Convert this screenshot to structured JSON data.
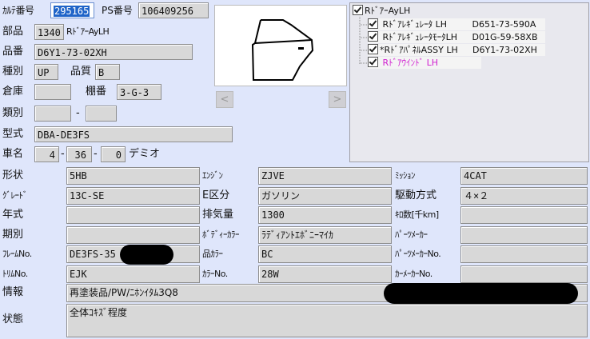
{
  "header": {
    "karte_label": "ｶﾙﾃ番号",
    "karte_value": "295165",
    "ps_label": "PS番号",
    "ps_value": "106409256"
  },
  "part": {
    "label": "部品",
    "code": "1340",
    "name": "RﾄﾞｱｰAyLH"
  },
  "part_number": {
    "label": "品番",
    "value": "D6Y1-73-02XH"
  },
  "kind": {
    "label": "種別",
    "value": "UP",
    "quality_label": "品質",
    "quality_value": "B"
  },
  "warehouse": {
    "label": "倉庫",
    "value": "",
    "shelf_label": "棚番",
    "shelf_value": "3-G-3"
  },
  "category": {
    "label": "類別",
    "value1": "",
    "sep": "-",
    "value2": ""
  },
  "model": {
    "label": "型式",
    "value": "DBA-DE3FS"
  },
  "car_name": {
    "label": "車名",
    "v1": "4",
    "v2": "36",
    "v3": "0",
    "sep": "-",
    "name": "デミオ"
  },
  "image_nav": {
    "prev": "<",
    "next": ">"
  },
  "tree": {
    "root": "RﾄﾞｱｰAyLH",
    "items": [
      {
        "name": "Rﾄﾞｱﾚｷﾞｭﾚｰﾀ LH",
        "code": "D651-73-590A"
      },
      {
        "name": "RﾄﾞｱﾚｷﾞｭﾚｰﾀﾓｰﾀLH",
        "code": "D01G-59-58XB"
      },
      {
        "name": "*RﾄﾞｱﾊﾟﾈﾙASSY LH",
        "code": "D6Y1-73-02XH"
      },
      {
        "name": "Rﾄﾞｱｳｲﾝﾄﾞ LH",
        "code": ""
      }
    ],
    "highlight_color": "#d020d0"
  },
  "grid": [
    [
      {
        "label": "形状",
        "value": "5HB"
      },
      {
        "label": "ｴﾝｼﾞﾝ",
        "value": "ZJVE"
      },
      {
        "label": "ﾐｯｼｮﾝ",
        "value": "4CAT"
      }
    ],
    [
      {
        "label": "ｸﾞﾚｰﾄﾞ",
        "value": "13C-SE"
      },
      {
        "label": "E区分",
        "value": "ガソリン"
      },
      {
        "label": "駆動方式",
        "value": "４×２"
      }
    ],
    [
      {
        "label": "年式",
        "value": ""
      },
      {
        "label": "排気量",
        "value": "1300"
      },
      {
        "label": "ｷﾛ数[千km]",
        "value": ""
      }
    ],
    [
      {
        "label": "期別",
        "value": ""
      },
      {
        "label": "ﾎﾞﾃﾞｨｰｶﾗｰ",
        "value": "ﾗﾃﾞｨｱﾝﾄｴﾎﾞﾆｰﾏｲｶ"
      },
      {
        "label": "ﾊﾟｰﾂﾒｰｶｰ",
        "value": ""
      }
    ],
    [
      {
        "label": "ﾌﾚｰﾑNo.",
        "value": "DE3FS-35"
      },
      {
        "label": "品ｶﾗｰ",
        "value": "BC"
      },
      {
        "label": "ﾊﾟｰﾂﾒｰｶｰNo.",
        "value": ""
      }
    ],
    [
      {
        "label": "ﾄﾘﾑNo.",
        "value": "EJK"
      },
      {
        "label": "ｶﾗｰNo.",
        "value": "28W"
      },
      {
        "label": "ｶｰﾒｰｶｰNo.",
        "value": ""
      }
    ]
  ],
  "info": {
    "label": "情報",
    "value": "再塗装品/PW/ﾆﾎﾝｲﾀﾑ3Q8"
  },
  "condition": {
    "label": "状態",
    "value": "全体ｺｷｽﾞ程度"
  }
}
